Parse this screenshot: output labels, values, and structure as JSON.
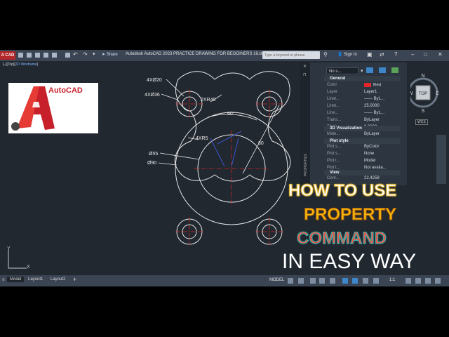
{
  "titlebar": {
    "logo": "A CAD",
    "share_label": "Share",
    "title": "Autodesk AutoCAD 2023    PRACTICE DRAWING FOR BEGGINERS 19.dwg",
    "search_placeholder": "Type a keyword or phrase",
    "signin_label": "Sign In"
  },
  "viewport": {
    "label_prefix": "[–][Top][",
    "label_style": "2D Wireframe",
    "label_suffix": "]"
  },
  "logo_card": {
    "brand": "AutoCAD"
  },
  "drawing": {
    "dims": {
      "d1": "4XØ20",
      "d2": "4XØ36",
      "d3": "2XR40",
      "d4": "60°",
      "d5": "4XR5",
      "d6": "60",
      "d7": "Ø55",
      "d8": "Ø90"
    }
  },
  "properties": {
    "selection": "No s...",
    "side_label": "PROPERTIES",
    "sections": {
      "general": "General",
      "viz": "3D Visualization",
      "plot": "Plot style",
      "view": "View"
    },
    "general_rows": [
      {
        "k": "Color",
        "v": "Red"
      },
      {
        "k": "Layer",
        "v": "Layer1"
      },
      {
        "k": "Linet...",
        "v": "—— ByL..."
      },
      {
        "k": "Linet...",
        "v": "25.0000"
      },
      {
        "k": "Line...",
        "v": "—— ByL..."
      },
      {
        "k": "Trans...",
        "v": "ByLayer"
      },
      {
        "k": "Thick...",
        "v": "0.0000"
      }
    ],
    "viz_rows": [
      {
        "k": "Mate...",
        "v": "ByLayer"
      }
    ],
    "plot_rows": [
      {
        "k": "Plot s...",
        "v": "ByColor"
      },
      {
        "k": "Plot s...",
        "v": "None"
      },
      {
        "k": "Plot t...",
        "v": "Model"
      },
      {
        "k": "Plot t...",
        "v": "Not availa..."
      }
    ],
    "view_rows": [
      {
        "k": "Cent...",
        "v": "22.4259"
      }
    ],
    "colors": {
      "color_swatch": "#e2262a"
    }
  },
  "viewcube": {
    "n": "N",
    "w": "W",
    "e": "E",
    "s": "S",
    "top": "TOP",
    "wcs": "WCS"
  },
  "ucs": {
    "y": "Y",
    "x": "X"
  },
  "overlay": {
    "line1": "HOW TO USE",
    "line2": "PROPERTY",
    "line3": "COMMAND",
    "line4": "IN EASY WAY"
  },
  "tabs": {
    "model": "Model",
    "layout1": "Layout1",
    "layout2": "Layout2",
    "add": "+",
    "status_model": "MODEL",
    "scale": "1:1"
  }
}
